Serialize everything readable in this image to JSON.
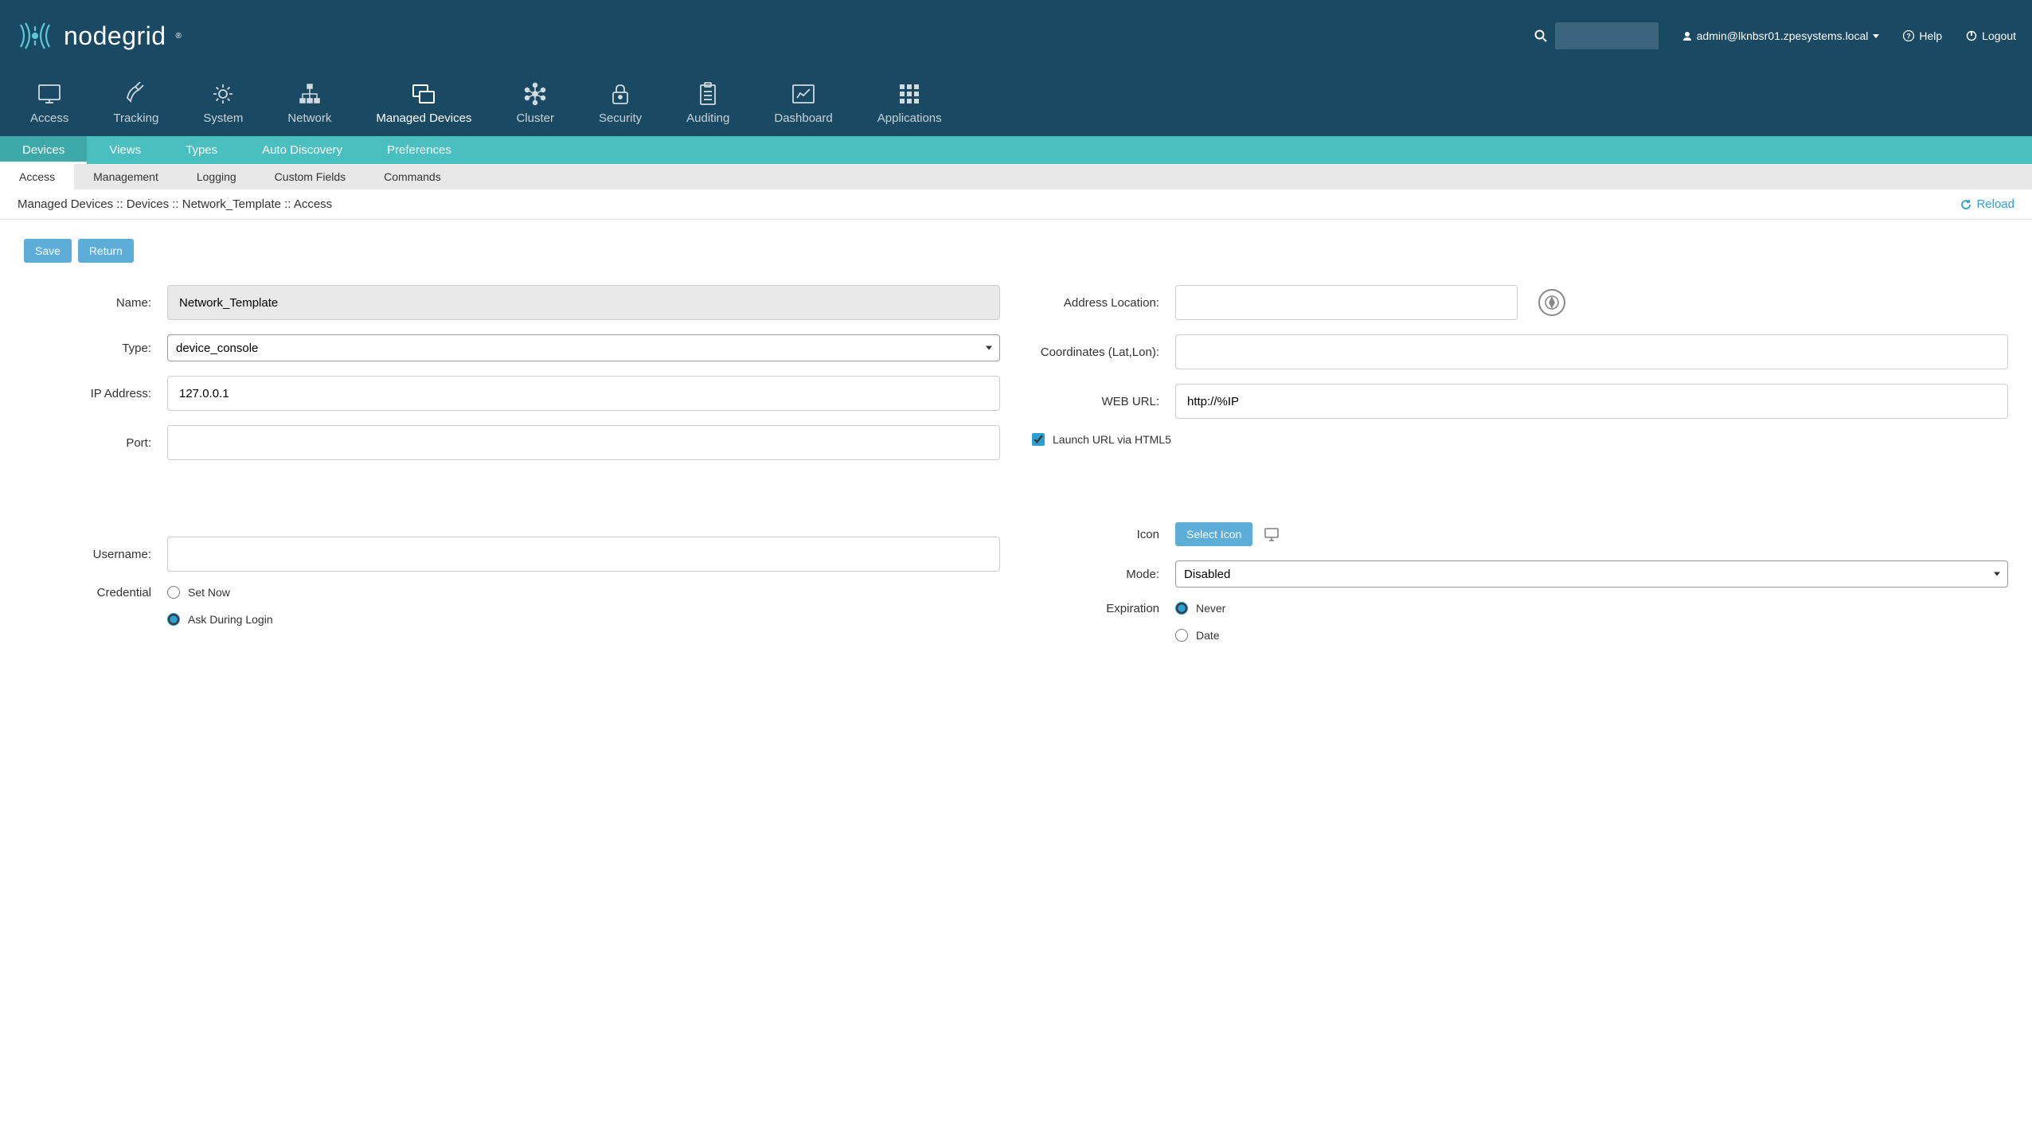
{
  "brand": "nodegrid",
  "header": {
    "user": "admin@lknbsr01.zpesystems.local",
    "help": "Help",
    "logout": "Logout"
  },
  "main_nav": [
    {
      "label": "Access",
      "icon": "monitor"
    },
    {
      "label": "Tracking",
      "icon": "satellite"
    },
    {
      "label": "System",
      "icon": "gear"
    },
    {
      "label": "Network",
      "icon": "network"
    },
    {
      "label": "Managed Devices",
      "icon": "windows",
      "active": true
    },
    {
      "label": "Cluster",
      "icon": "nodes"
    },
    {
      "label": "Security",
      "icon": "lock"
    },
    {
      "label": "Auditing",
      "icon": "clipboard"
    },
    {
      "label": "Dashboard",
      "icon": "chart"
    },
    {
      "label": "Applications",
      "icon": "grid"
    }
  ],
  "sub_nav": [
    {
      "label": "Devices",
      "active": true
    },
    {
      "label": "Views"
    },
    {
      "label": "Types"
    },
    {
      "label": "Auto Discovery"
    },
    {
      "label": "Preferences"
    }
  ],
  "subsub_nav": [
    {
      "label": "Access",
      "active": true
    },
    {
      "label": "Management"
    },
    {
      "label": "Logging"
    },
    {
      "label": "Custom Fields"
    },
    {
      "label": "Commands"
    }
  ],
  "breadcrumb": "Managed Devices :: Devices :: Network_Template :: Access",
  "reload": "Reload",
  "buttons": {
    "save": "Save",
    "return": "Return",
    "select_icon": "Select Icon"
  },
  "form": {
    "labels": {
      "name": "Name:",
      "type": "Type:",
      "ip": "IP Address:",
      "port": "Port:",
      "username": "Username:",
      "credential": "Credential",
      "address_location": "Address Location:",
      "coordinates": "Coordinates (Lat,Lon):",
      "web_url": "WEB URL:",
      "launch_html5": "Launch URL via HTML5",
      "icon": "Icon",
      "mode": "Mode:",
      "expiration": "Expiration"
    },
    "values": {
      "name": "Network_Template",
      "type": "device_console",
      "ip": "127.0.0.1",
      "port": "",
      "username": "",
      "address_location": "",
      "coordinates": "",
      "web_url": "http://%IP",
      "launch_html5": true,
      "mode": "Disabled"
    },
    "credential_options": {
      "set_now": "Set Now",
      "ask_login": "Ask During Login"
    },
    "expiration_options": {
      "never": "Never",
      "date": "Date"
    }
  }
}
